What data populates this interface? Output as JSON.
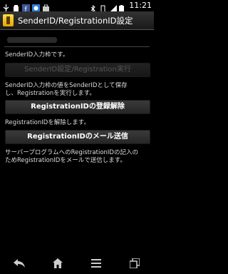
{
  "status": {
    "time": "11:21"
  },
  "app": {
    "title": "SenderID/RegistrationID設定"
  },
  "main": {
    "sender_label": "SenderID入力枠です。",
    "sender_button": "SenderID設定/Registration実行",
    "sender_desc_1": "SenderID入力枠の値をSenderIDとして保存",
    "sender_desc_2": "し、Registrationを実行します。",
    "unregister_button": "RegistrationIDの登録解除",
    "unregister_desc": "RegistrationIDを解除します。",
    "mail_button": "RegistrationIDのメール送信",
    "mail_desc_1": "サーバープログラムへのRegistrationIDの記入の",
    "mail_desc_2": "ためRegistrationIDをメールで送信します。"
  },
  "nav": [
    "back-icon",
    "home-icon",
    "menu-icon",
    "recent-apps-icon"
  ]
}
